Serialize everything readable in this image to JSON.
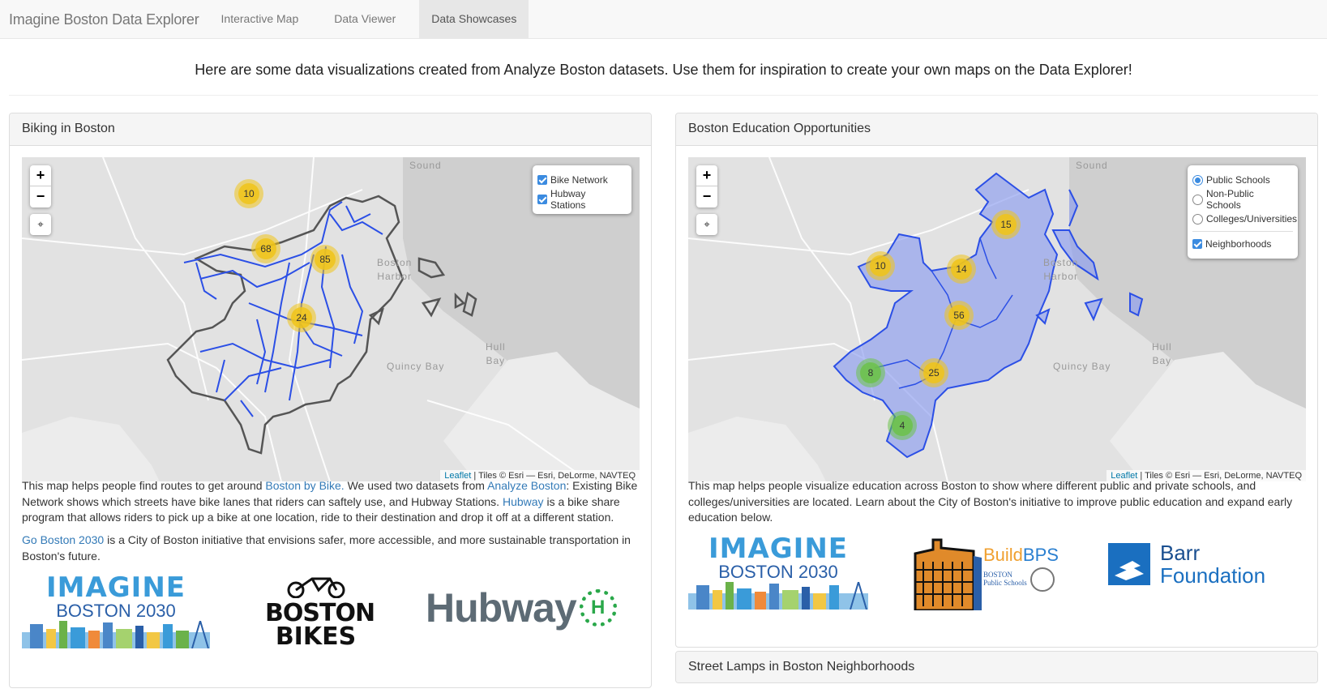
{
  "navbar": {
    "brand": "Imagine Boston Data Explorer",
    "links": [
      "Interactive Map",
      "Data Viewer",
      "Data Showcases"
    ],
    "active": "Data Showcases"
  },
  "intro": "Here are some data visualizations created from Analyze Boston datasets. Use them for inspiration to create your own maps on the Data Explorer!",
  "biking": {
    "title": "Biking in Boston",
    "layers": [
      "Bike Network",
      "Hubway Stations"
    ],
    "clusters": [
      "10",
      "68",
      "85",
      "24"
    ],
    "desc1_a": "This map helps people find routes to get around ",
    "desc1_link1": "Boston by Bike.",
    "desc1_b": " We used two datasets from ",
    "desc1_link2": "Analyze Boston",
    "desc1_c": ": Existing Bike Network shows which streets have bike lanes that riders can saftely use, and Hubway Stations. ",
    "desc1_link3": "Hubway",
    "desc1_d": " is a bike share program that allows riders to pick up a bike at one location, ride to their destination and drop it off at a different station.",
    "desc2_link": "Go Boston 2030",
    "desc2_text": " is a City of Boston initiative that envisions safer, more accessible, and more sustainable transportation in Boston's future.",
    "logos": {
      "imagine_top": "IMAGINE",
      "imagine_bottom": "BOSTON 2030",
      "bikes_top": "BOSTON",
      "bikes_bottom": "BIKES",
      "hubway": "Hubway",
      "hubway_mark": "H"
    }
  },
  "education": {
    "title": "Boston Education Opportunities",
    "layers": [
      "Public Schools",
      "Non-Public Schools",
      "Colleges/Universities",
      "Neighborhoods"
    ],
    "clusters": [
      "15",
      "10",
      "14",
      "56",
      "8",
      "25",
      "4"
    ],
    "desc": "This map helps people visualize education across Boston to show where different public and private schools, and colleges/universities are located. Learn about the City of Boston's initiative to improve public education and expand early education below.",
    "logos": {
      "imagine_top": "IMAGINE",
      "imagine_bottom": "BOSTON 2030",
      "build": "Build",
      "bps": "BPS",
      "bps_sub1": "BOSTON",
      "bps_sub2": "Public Schools",
      "barr1": "Barr",
      "barr2": "Foundation"
    }
  },
  "street_lamps": {
    "title": "Street Lamps in Boston Neighborhoods"
  },
  "map_common": {
    "zoom_in": "+",
    "zoom_out": "−",
    "locate": "⌖",
    "attr_link": "Leaflet",
    "attr_text": " | Tiles © Esri — Esri, DeLorme, NAVTEQ",
    "places": {
      "sound": "Sound",
      "harbor1": "Boston",
      "harbor2": "Harbor",
      "hull1": "Hull",
      "hull2": "Bay",
      "quincy": "Quincy Bay"
    }
  },
  "colors": {
    "bike_line": "#2b4fe6",
    "cluster_yellow": "#f0c419",
    "cluster_green": "#6cc24a",
    "neighborhood_fill": "#8c9cf0"
  }
}
